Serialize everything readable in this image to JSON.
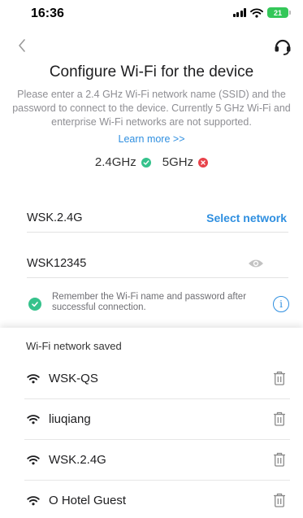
{
  "status": {
    "time": "16:36",
    "battery": "21"
  },
  "header": {
    "title": "Configure Wi-Fi for the device"
  },
  "description": "Please enter a 2.4 GHz Wi-Fi network name (SSID) and the password to connect to the device. Currently 5 GHz Wi-Fi and enterprise Wi-Fi networks are not supported.",
  "learn_more": "Learn more >>",
  "bands": [
    {
      "label": "2.4GHz",
      "supported": true
    },
    {
      "label": "5GHz",
      "supported": false
    }
  ],
  "form": {
    "ssid": "WSK.2.4G",
    "select_network": "Select network",
    "password": "WSK12345",
    "remember_text": "Remember the Wi-Fi name and password after successful connection."
  },
  "saved": {
    "title": "Wi-Fi network saved",
    "networks": [
      "WSK-QS",
      "liuqiang",
      "WSK.2.4G",
      "O Hotel Guest"
    ]
  },
  "colors": {
    "accent": "#2f8fe0",
    "success": "#35c28c",
    "error": "#e8424a"
  },
  "icons": [
    "back-icon",
    "headset-icon",
    "check-icon",
    "close-icon",
    "eye-icon",
    "info-icon",
    "wifi-icon",
    "trash-icon"
  ]
}
